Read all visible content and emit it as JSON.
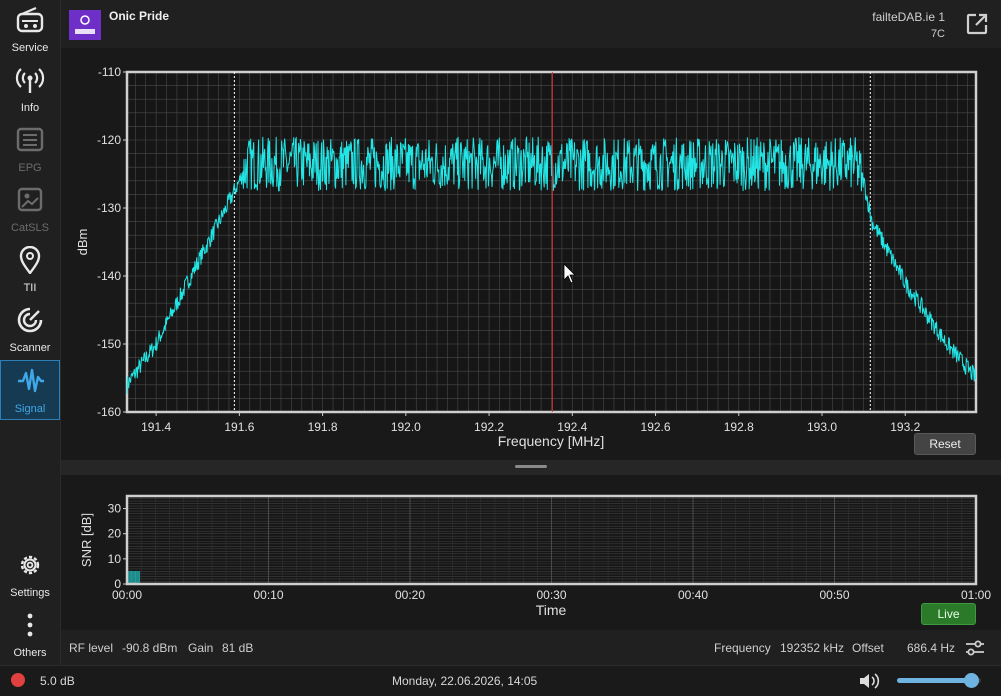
{
  "sidebar": {
    "items": [
      {
        "label": "Service",
        "icon": "radio-icon"
      },
      {
        "label": "Info",
        "icon": "broadcast-icon"
      },
      {
        "label": "EPG",
        "icon": "list-icon"
      },
      {
        "label": "CatSLS",
        "icon": "image-icon"
      },
      {
        "label": "TII",
        "icon": "location-pin-icon"
      },
      {
        "label": "Scanner",
        "icon": "scanner-icon"
      },
      {
        "label": "Signal",
        "icon": "signal-wave-icon"
      }
    ],
    "bottom": [
      {
        "label": "Settings",
        "icon": "gear-icon"
      },
      {
        "label": "Others",
        "icon": "more-vertical-icon"
      }
    ]
  },
  "header": {
    "station": "Onic Pride",
    "ensemble": "failteDAB.ie 1",
    "channel": "7C"
  },
  "spectrum": {
    "reset_label": "Reset"
  },
  "snr": {
    "live_label": "Live"
  },
  "status": {
    "rf_label": "RF level",
    "rf_value": "-90.8 dBm",
    "gain_label": "Gain",
    "gain_value": "81 dB",
    "freq_label": "Frequency",
    "freq_value": "192352 kHz",
    "offset_label": "Offset",
    "offset_value": "686.4 Hz"
  },
  "footer": {
    "snr_value": "5.0 dB",
    "datetime": "Monday, 22.06.2026, 14:05",
    "volume_level": 0.88
  },
  "colors": {
    "trace": "#22e6e6",
    "marker": "#e03030",
    "accent": "#2d7fb8",
    "record_dot": "#e04040",
    "live_green": "#2a7a2a"
  },
  "chart_data": [
    {
      "type": "line",
      "xlabel": "Frequency [MHz]",
      "ylabel": "dBm",
      "xlim": [
        191.33,
        193.37
      ],
      "ylim": [
        -160,
        -110
      ],
      "xticks": [
        "191.4",
        "191.6",
        "191.8",
        "192.0",
        "192.2",
        "192.4",
        "192.6",
        "192.8",
        "193.0",
        "193.2"
      ],
      "xtick_values": [
        191.4,
        191.6,
        191.8,
        192.0,
        192.2,
        192.4,
        192.6,
        192.8,
        193.0,
        193.2
      ],
      "yticks": [
        "-110",
        "-120",
        "-130",
        "-140",
        "-150",
        "-160"
      ],
      "ytick_values": [
        -110,
        -120,
        -130,
        -140,
        -150,
        -160
      ],
      "grid": true,
      "marker_freq": 192.352,
      "band_edges": [
        191.588,
        193.116
      ],
      "envelope": {
        "x": [
          191.33,
          191.4,
          191.5,
          191.56,
          191.6,
          191.62,
          193.08,
          193.1,
          193.12,
          193.2,
          193.3,
          193.37
        ],
        "y": [
          -156,
          -150,
          -138,
          -131,
          -126,
          -123.5,
          -123.5,
          -126,
          -132,
          -141,
          -150,
          -155
        ]
      },
      "ripple_db": 4
    },
    {
      "type": "bar",
      "xlabel": "Time",
      "ylabel": "SNR [dB]",
      "xlim": [
        0,
        60
      ],
      "ylim": [
        0,
        35
      ],
      "xticks": [
        "00:00",
        "00:10",
        "00:20",
        "00:30",
        "00:40",
        "00:50",
        "01:00"
      ],
      "xtick_values": [
        0,
        10,
        20,
        30,
        40,
        50,
        60
      ],
      "yticks": [
        "0",
        "10",
        "20",
        "30"
      ],
      "ytick_values": [
        0,
        10,
        20,
        30
      ],
      "grid": true,
      "x": [
        0,
        0.3,
        0.6
      ],
      "values": [
        5.0,
        5.0,
        5.0
      ]
    }
  ]
}
